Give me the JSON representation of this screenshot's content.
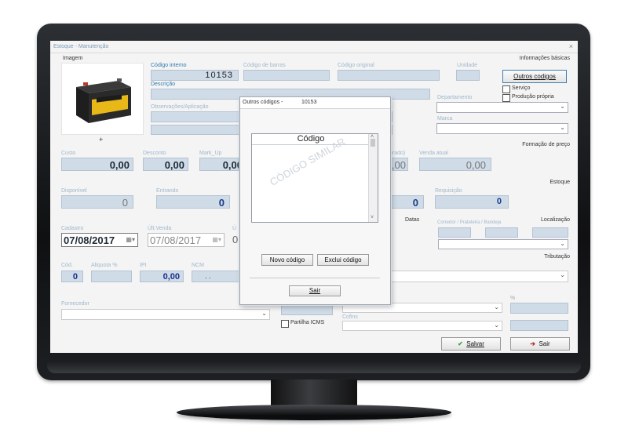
{
  "window": {
    "title": "Estoque - Manutenção",
    "close": "×"
  },
  "image_section": {
    "label": "Imagem",
    "add": "+"
  },
  "basic": {
    "section": "Informações básicas",
    "codigo_interno": {
      "label": "Código interno",
      "value": "10153"
    },
    "codigo_barras": {
      "label": "Código de barras",
      "value": ""
    },
    "codigo_original": {
      "label": "Código original",
      "value": ""
    },
    "unidade": {
      "label": "Unidade",
      "value": ""
    },
    "descricao": {
      "label": "Descrição",
      "value": ""
    },
    "observacoes": {
      "label": "Observações/Aplicação",
      "value": ""
    },
    "departamento": {
      "label": "Departamento",
      "value": ""
    },
    "marca": {
      "label": "Marca",
      "value": ""
    },
    "outros_codigos_button": "Outros codigos",
    "servico": "Serviço",
    "producao_propria": "Produção própria"
  },
  "pricing": {
    "section": "Formação de preço",
    "custo": {
      "label": "Custo",
      "value": "0,00"
    },
    "desconto": {
      "label": "Desconto",
      "value": "0,00"
    },
    "markup": {
      "label": "Mark_Up",
      "value": "0,00"
    },
    "gerado": {
      "label": "erado)",
      "value": ",00"
    },
    "venda_atual": {
      "label": "Venda atual",
      "value": "0,00"
    }
  },
  "stock": {
    "section": "Estoque",
    "disponivel": {
      "label": "Disponível",
      "value": "0"
    },
    "entrando": {
      "label": "Entrando",
      "value": "0"
    },
    "right_val": "0",
    "requisicao": {
      "label": "Requisição",
      "value": "0"
    }
  },
  "dates": {
    "section": "Datas",
    "cadastro": {
      "label": "Cadastro",
      "value": "07/08/2017"
    },
    "ult_venda": {
      "label": "Últ.Venda",
      "value": "07/08/2017"
    },
    "cut": "Ú",
    "cut_val": "0"
  },
  "location": {
    "section": "Localização",
    "sublabel": "Corredor / Prateleira / Bandeja"
  },
  "tax": {
    "section": "Tributação",
    "cod": {
      "label": "Cód.",
      "value": "0"
    },
    "aliquota": {
      "label": "Aliquota %"
    },
    "ipi": {
      "label": "IPI",
      "value": "0,00"
    },
    "ncm": {
      "label": "NCM",
      "value": ". ."
    },
    "percent": "%",
    "partilha": "Partilha ICMS",
    "cofins": "Cofins"
  },
  "fornecedor": {
    "label": "Fornecedor"
  },
  "footer": {
    "salvar": "Salvar",
    "sair": "Sair"
  },
  "dialog": {
    "title": "Outros códigos -",
    "code": "10153",
    "column": "Código",
    "watermark": "CÓDIGO SIMILAR",
    "novo": "Novo código",
    "exclui": "Exclui código",
    "sair": "Sair"
  }
}
